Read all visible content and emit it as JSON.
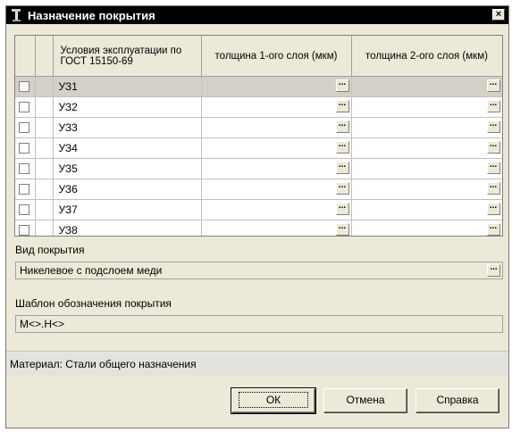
{
  "window": {
    "title": "Назначение покрытия",
    "close_glyph": "×"
  },
  "grid": {
    "columns": [
      "",
      "",
      "Условия эксплуатации по ГОСТ 15150-69",
      "толщина 1-ого слоя (мкм)",
      "толщина 2-ого слоя (мкм)"
    ],
    "rows": [
      {
        "condition": "УЗ1",
        "selected": true
      },
      {
        "condition": "УЗ2",
        "selected": false
      },
      {
        "condition": "УЗ3",
        "selected": false
      },
      {
        "condition": "УЗ4",
        "selected": false
      },
      {
        "condition": "УЗ5",
        "selected": false
      },
      {
        "condition": "УЗ6",
        "selected": false
      },
      {
        "condition": "УЗ7",
        "selected": false
      },
      {
        "condition": "УЗ8",
        "selected": false
      }
    ],
    "ellipsis": "..."
  },
  "coating_type": {
    "label": "Вид покрытия",
    "value": "Никелевое с подслоем меди"
  },
  "template": {
    "label": "Шаблон обозначения покрытия",
    "value": "М<>.Н<>"
  },
  "status": {
    "text": "Материал: Стали общего назначения"
  },
  "buttons": {
    "ok": "ОК",
    "cancel": "Отмена",
    "help": "Справка"
  },
  "colors": {
    "titlebar": "#000000",
    "window_bg": "#ece9d8",
    "selected_row": "#d4d0c8"
  }
}
